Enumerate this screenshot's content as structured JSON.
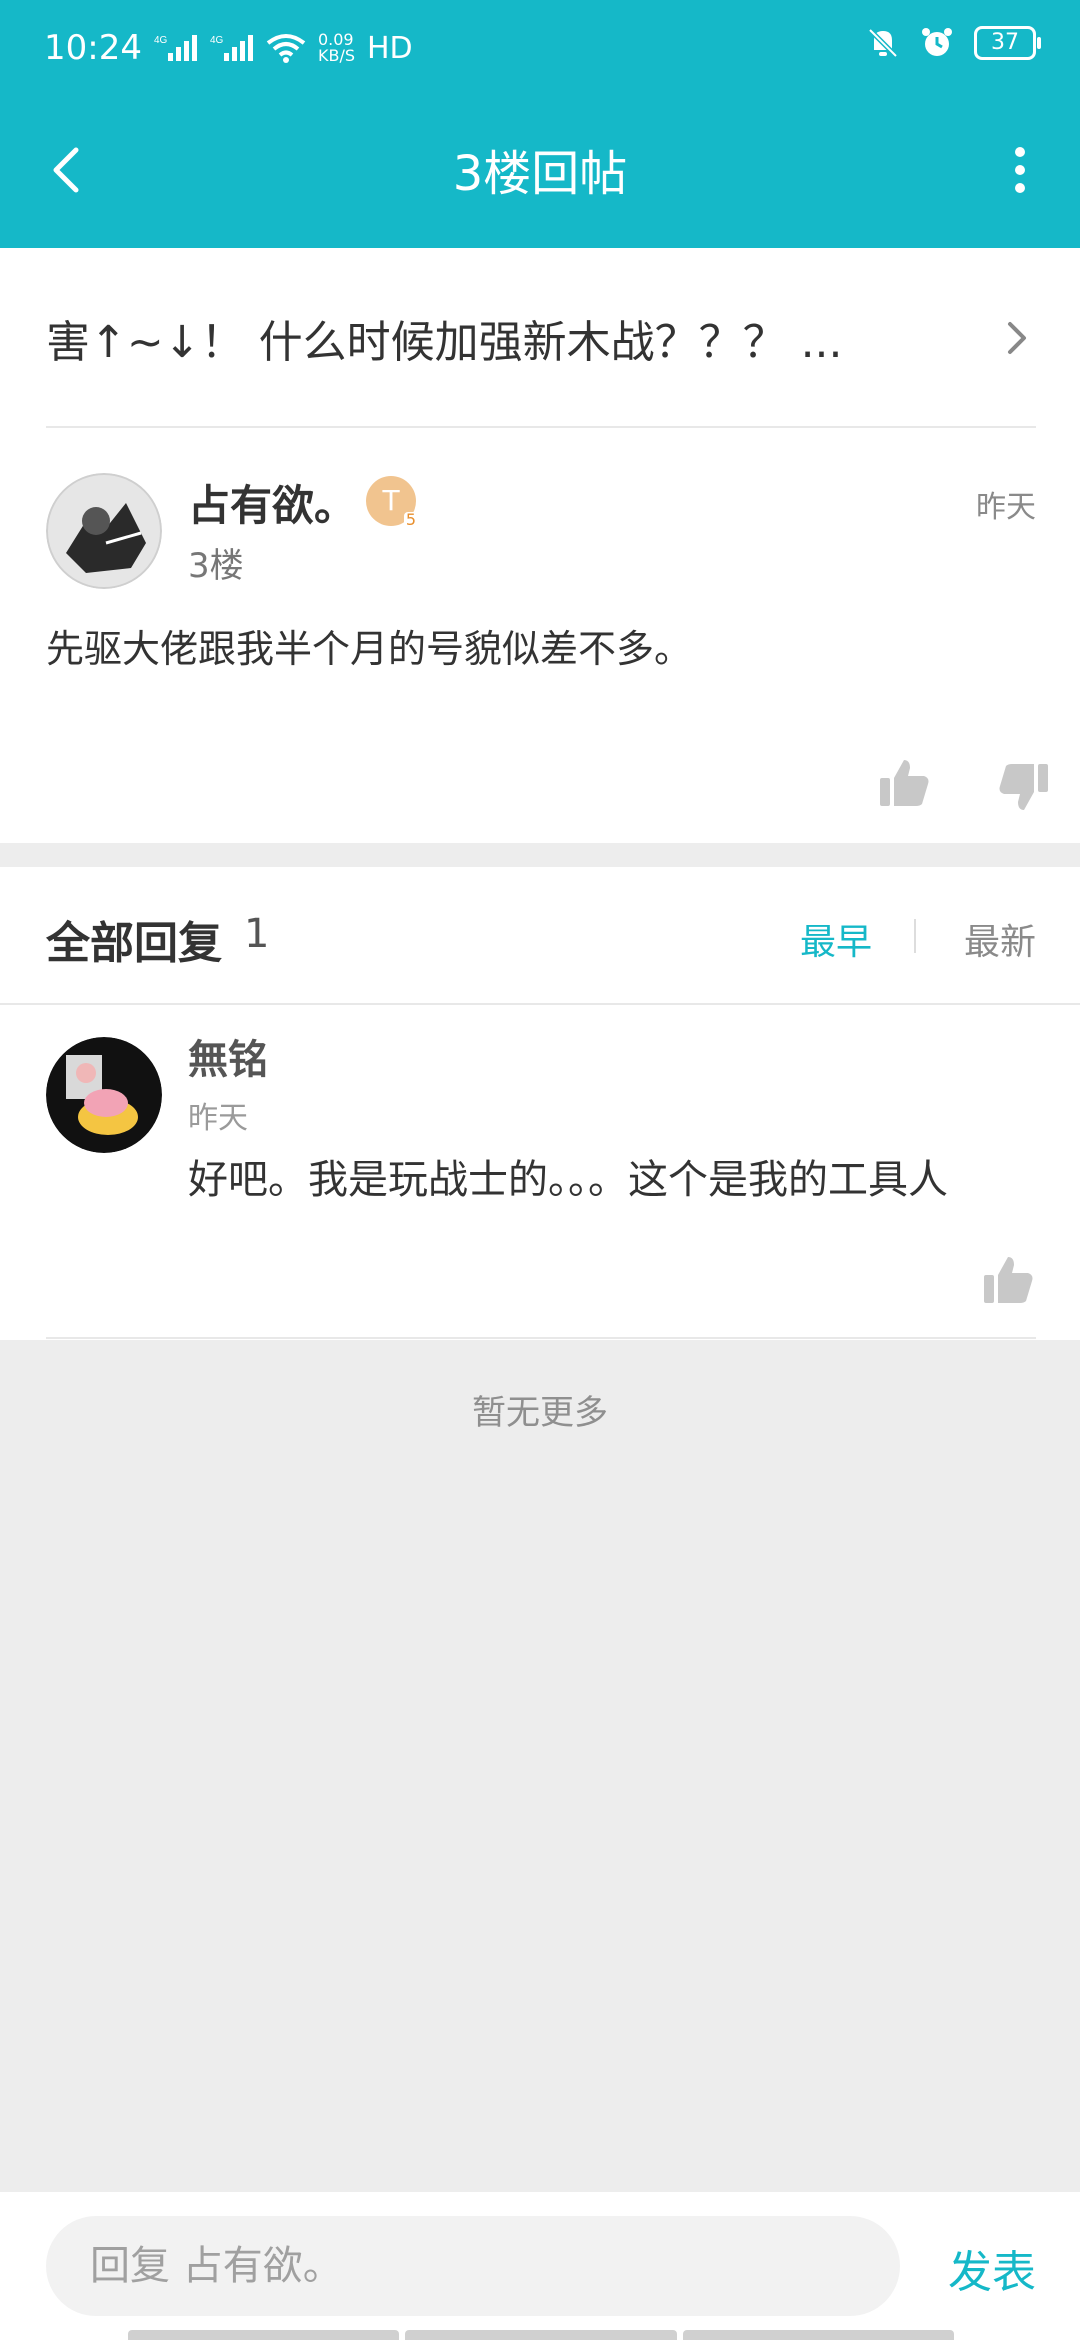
{
  "status_bar": {
    "time": "10:24",
    "network1": "4G",
    "network2": "4G",
    "speed_value": "0.09",
    "speed_unit": "KB/S",
    "hd": "HD",
    "battery": "37"
  },
  "header": {
    "title": "3楼回帖"
  },
  "thread": {
    "title": "害↑~↓！ 什么时候加强新木战？？？ ..."
  },
  "post": {
    "author": "占有欲。",
    "level_badge": "T",
    "level_num": "5",
    "floor": "3楼",
    "time": "昨天",
    "content": "先驱大佬跟我半个月的号貌似差不多。"
  },
  "replies_section": {
    "title": "全部回复",
    "count": "1",
    "sort_earliest": "最早",
    "sort_latest": "最新"
  },
  "replies": [
    {
      "author": "無铭",
      "time": "昨天",
      "content": "好吧。我是玩战士的。。。这个是我的工具人"
    }
  ],
  "footer_note": "暂无更多",
  "bottom_bar": {
    "placeholder": "回复 占有欲。",
    "send_label": "发表"
  },
  "colors": {
    "accent": "#15b8c8",
    "background": "#ededed"
  }
}
